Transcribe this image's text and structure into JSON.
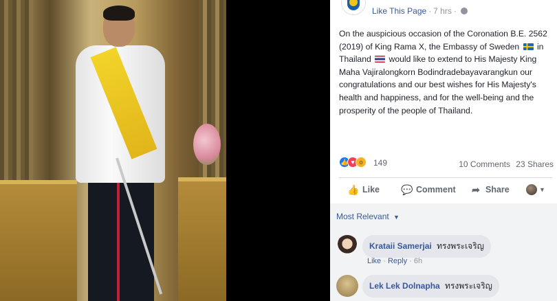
{
  "post": {
    "header": {
      "like_page": "Like This Page",
      "time": "7 hrs"
    },
    "body_parts": {
      "p1": "On the auspicious occasion of the Coronation B.E. 2562 (2019) of King Rama X, the Embassy of Sweden",
      "p2": "in Thailand",
      "p3": "would like to extend to His Majesty King Maha Vajiralongkorn Bodindradebayavarangkun our congratulations and our best wishes for His Majesty's health and happiness, and for the well-being and the prosperity of the people of Thailand."
    },
    "reactions": {
      "count": "149",
      "comments": "10 Comments",
      "shares": "23 Shares"
    },
    "actions": {
      "like": "Like",
      "comment": "Comment",
      "share": "Share"
    }
  },
  "comments": {
    "sort_label": "Most Relevant",
    "items": [
      {
        "name": "Krataii Samerjai",
        "text": "ทรงพระเจริญ",
        "like": "Like",
        "reply": "Reply",
        "time": "6h"
      },
      {
        "name": "Lek Lek Dolnapha",
        "text": "ทรงพระเจริญ"
      }
    ]
  },
  "colors": {
    "link": "#385898",
    "secondary_text": "#90949c",
    "body_text": "#1d2129",
    "comment_bg": "#f2f3f5"
  }
}
